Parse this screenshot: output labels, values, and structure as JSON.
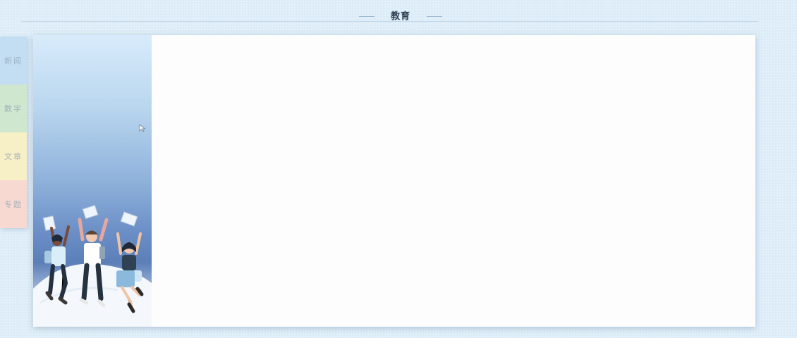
{
  "section": {
    "title": "教育"
  },
  "side_tabs": [
    {
      "label": "新闻",
      "color": "#c3def2"
    },
    {
      "label": "数字",
      "color": "#cfe7cf"
    },
    {
      "label": "文章",
      "color": "#f7efc6"
    },
    {
      "label": "专题",
      "color": "#f7d9d2"
    }
  ],
  "hero": {
    "illustration": "students-celebrating-throwing-papers",
    "gradient_top": "#d8ebfb",
    "gradient_mid": "#5c7fb8"
  },
  "colors": {
    "page_background": "#dcecf8",
    "card_background": "#fdfdfe",
    "title_text": "#2d3e52"
  },
  "icons": {
    "cursor": "mouse-pointer-icon"
  }
}
